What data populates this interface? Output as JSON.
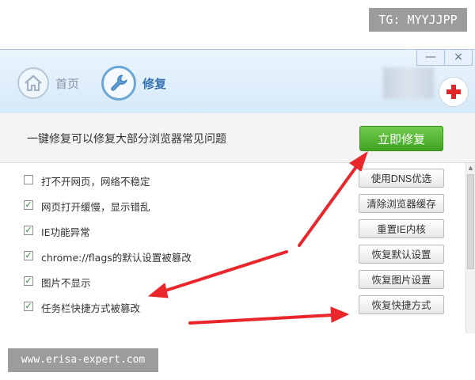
{
  "watermark_top": "TG: MYYJJPP",
  "watermark_bottom": "www.erisa-expert.com",
  "window": {
    "minimize": "—",
    "close": "×"
  },
  "tabs": [
    {
      "label": "首页",
      "icon": "home-icon",
      "active": false
    },
    {
      "label": "修复",
      "icon": "wrench-icon",
      "active": true
    }
  ],
  "banner": {
    "text": "一键修复可以修复大部分浏览器常见问题",
    "button": "立即修复"
  },
  "items": [
    {
      "label": "打不开网页，网络不稳定",
      "checked": false,
      "button": "使用DNS优选"
    },
    {
      "label": "网页打开缓慢，显示错乱",
      "checked": true,
      "button": "清除浏览器缓存"
    },
    {
      "label": "IE功能异常",
      "checked": true,
      "button": "重置IE内核"
    },
    {
      "label": "chrome://flags的默认设置被篡改",
      "checked": true,
      "button": "恢复默认设置"
    },
    {
      "label": "图片不显示",
      "checked": true,
      "button": "恢复图片设置"
    },
    {
      "label": "任务栏快捷方式被篡改",
      "checked": true,
      "button": "恢复快捷方式"
    }
  ],
  "colors": {
    "accent": "#3672b3",
    "fix_button": "#4cb22c",
    "annotation_arrow": "#e8262b",
    "check": "#2f8f2f"
  }
}
